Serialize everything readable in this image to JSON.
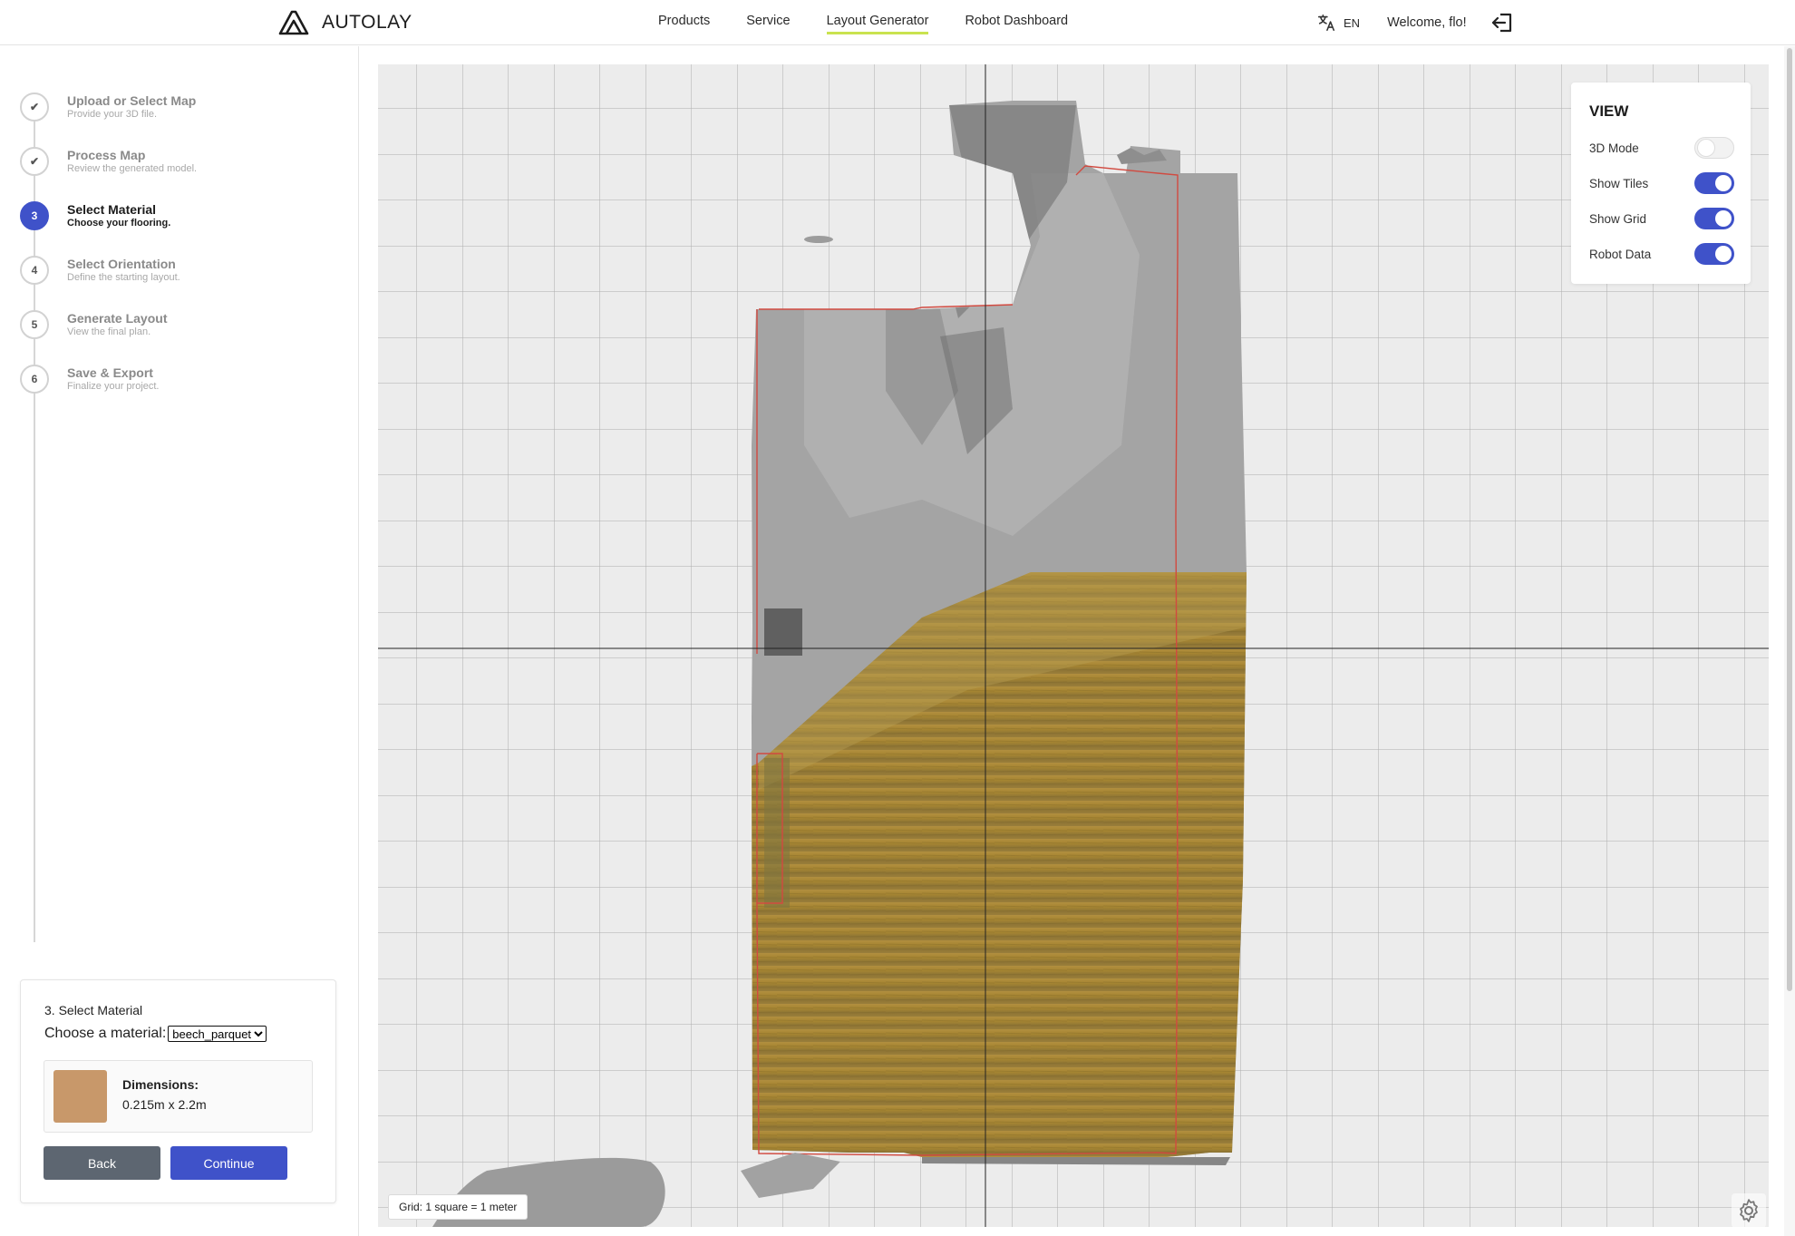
{
  "header": {
    "brand": "AUTOLAY",
    "nav": [
      {
        "label": "Products"
      },
      {
        "label": "Service"
      },
      {
        "label": "Layout Generator"
      },
      {
        "label": "Robot Dashboard"
      }
    ],
    "language": "EN",
    "welcome": "Welcome, flo!"
  },
  "steps": [
    {
      "number": "✔",
      "title": "Upload or Select Map",
      "subtitle": "Provide your 3D file."
    },
    {
      "number": "✔",
      "title": "Process Map",
      "subtitle": "Review the generated model."
    },
    {
      "number": "3",
      "title": "Select Material",
      "subtitle": "Choose your flooring."
    },
    {
      "number": "4",
      "title": "Select Orientation",
      "subtitle": "Define the starting layout."
    },
    {
      "number": "5",
      "title": "Generate Layout",
      "subtitle": "View the final plan."
    },
    {
      "number": "6",
      "title": "Save & Export",
      "subtitle": "Finalize your project."
    }
  ],
  "material_panel": {
    "title": "3. Select Material",
    "choose_label": "Choose a material:",
    "selected_material": "beech_parquet",
    "dimensions_label": "Dimensions:",
    "dimensions_value": "0.215m x 2.2m",
    "swatch_color": "#c8986a",
    "back_label": "Back",
    "continue_label": "Continue"
  },
  "view_panel": {
    "title": "VIEW",
    "toggles": [
      {
        "label": "3D Mode",
        "on": false
      },
      {
        "label": "Show Tiles",
        "on": true
      },
      {
        "label": "Show Grid",
        "on": true
      },
      {
        "label": "Robot Data",
        "on": true
      }
    ]
  },
  "viewport": {
    "grid_label": "Grid: 1 square = 1 meter"
  },
  "colors": {
    "accent": "#3f52c9",
    "nav_underline": "#c9e34f",
    "back_button": "#5d6671",
    "parquet": "#a98a3a"
  }
}
